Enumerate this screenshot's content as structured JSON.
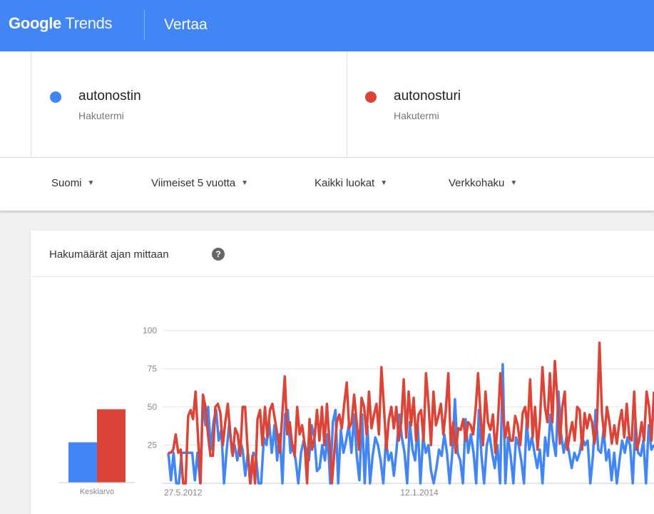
{
  "header": {
    "logo_google": "Google",
    "logo_trends": "Trends",
    "page_title": "Vertaa"
  },
  "terms": [
    {
      "name": "autonostin",
      "type": "Hakutermi",
      "color": "#4285f4"
    },
    {
      "name": "autonosturi",
      "type": "Hakutermi",
      "color": "#db4437"
    }
  ],
  "filters": [
    {
      "label": "Suomi"
    },
    {
      "label": "Viimeiset 5 vuotta"
    },
    {
      "label": "Kaikki luokat"
    },
    {
      "label": "Verkkohaku"
    }
  ],
  "card": {
    "title": "Hakumäärät ajan mittaan",
    "help_icon": "help-icon"
  },
  "colors": {
    "accent": "#4285f4",
    "series1": "#4285f4",
    "series2": "#db4437"
  },
  "chart_data": [
    {
      "type": "bar",
      "categories": [
        "Keskiarvo"
      ],
      "series": [
        {
          "name": "autonostin",
          "values": [
            22
          ]
        },
        {
          "name": "autonosturi",
          "values": [
            40
          ]
        }
      ],
      "ylim": [
        0,
        100
      ]
    },
    {
      "type": "line",
      "ylim": [
        0,
        100
      ],
      "yticks": [
        25,
        50,
        75,
        100
      ],
      "xticks": [
        "27.5.2012",
        "12.1.2014"
      ],
      "series": [
        {
          "name": "autonostin",
          "values": [
            20,
            2,
            20,
            0,
            0,
            20,
            20,
            20,
            20,
            20,
            2,
            20,
            0,
            55,
            38,
            50,
            22,
            40,
            48,
            28,
            35,
            0,
            22,
            40,
            20,
            25,
            15,
            28,
            22,
            5,
            20,
            0,
            20,
            18,
            0,
            0,
            30,
            25,
            40,
            20,
            38,
            15,
            32,
            0,
            45,
            48,
            20,
            25,
            15,
            0,
            20,
            28,
            22,
            15,
            38,
            30,
            8,
            10,
            25,
            15,
            32,
            0,
            40,
            48,
            0,
            35,
            20,
            28,
            38,
            20,
            45,
            18,
            2,
            45,
            0,
            38,
            0,
            18,
            30,
            25,
            15,
            0,
            28,
            15,
            20,
            5,
            22,
            45,
            30,
            20,
            0,
            40,
            22,
            15,
            38,
            0,
            30,
            20,
            25,
            8,
            0,
            10,
            22,
            18,
            32,
            20,
            0,
            20,
            55,
            20,
            15,
            0,
            42,
            20,
            32,
            20,
            0,
            48,
            18,
            0,
            25,
            32,
            20,
            10,
            25,
            0,
            78,
            0,
            30,
            18,
            0,
            30,
            25,
            15,
            0,
            40,
            22,
            30,
            20,
            10,
            22,
            0,
            30,
            18,
            45,
            28,
            18,
            60,
            32,
            20,
            30,
            20,
            10,
            20,
            15,
            20,
            30,
            25,
            28,
            0,
            18,
            48,
            22,
            20,
            35,
            15,
            22,
            2,
            20,
            0,
            15,
            28,
            20,
            30,
            25,
            0,
            40,
            20,
            18,
            28,
            0,
            38,
            22,
            25
          ],
          "x_range": [
            "27.5.2012",
            "2017-05"
          ]
        },
        {
          "name": "autonosturi",
          "values": [
            20,
            20,
            22,
            32,
            20,
            22,
            0,
            0,
            44,
            48,
            42,
            60,
            30,
            0,
            58,
            50,
            32,
            18,
            18,
            50,
            52,
            46,
            25,
            40,
            52,
            32,
            18,
            36,
            32,
            18,
            50,
            50,
            22,
            0,
            18,
            0,
            42,
            48,
            25,
            50,
            30,
            48,
            52,
            42,
            32,
            20,
            45,
            70,
            32,
            40,
            25,
            18,
            50,
            32,
            38,
            26,
            0,
            42,
            22,
            30,
            48,
            28,
            50,
            25,
            52,
            28,
            0,
            20,
            40,
            45,
            36,
            52,
            66,
            36,
            40,
            58,
            40,
            22,
            56,
            50,
            32,
            60,
            36,
            45,
            52,
            32,
            76,
            50,
            22,
            42,
            50,
            36,
            50,
            28,
            40,
            68,
            30,
            60,
            38,
            56,
            28,
            45,
            48,
            28,
            72,
            52,
            25,
            60,
            38,
            44,
            52,
            32,
            48,
            72,
            25,
            40,
            20,
            36,
            35,
            42,
            28,
            40,
            38,
            32,
            48,
            72,
            45,
            25,
            60,
            40,
            35,
            45,
            20,
            40,
            72,
            46,
            30,
            40,
            28,
            28,
            44,
            38,
            25,
            46,
            50,
            36,
            68,
            30,
            50,
            22,
            42,
            76,
            50,
            40,
            72,
            40,
            80,
            55,
            26,
            50,
            60,
            22,
            32,
            40,
            28,
            50,
            48,
            22,
            46,
            36,
            45,
            40,
            26,
            40,
            92,
            46,
            30,
            50,
            40,
            26,
            38,
            26,
            40,
            48,
            30,
            52,
            30,
            28,
            60,
            22,
            28,
            40,
            28,
            60,
            50,
            28,
            60
          ]
        }
      ]
    }
  ]
}
